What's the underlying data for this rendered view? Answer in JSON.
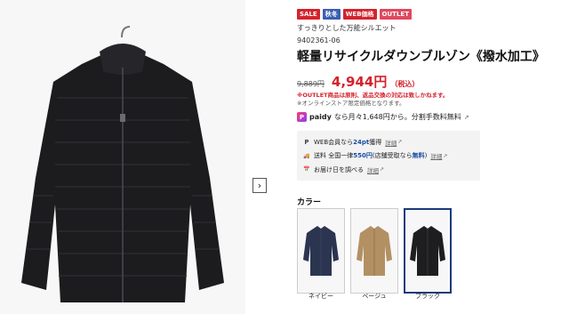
{
  "product": {
    "badges": [
      {
        "label": "SALE",
        "color": "#d4232c"
      },
      {
        "label": "秋冬",
        "color": "#3a5fb0"
      },
      {
        "label": "WEB価格",
        "color": "#d4232c"
      },
      {
        "label": "OUTLET",
        "color": "#e0485e"
      }
    ],
    "tagline": "すっきりとした万能シルエット",
    "code": "9402361-06",
    "title": "軽量リサイクルダウンブルゾン《撥水加工》",
    "old_price": "9,889円",
    "price": "4,944円",
    "tax_label": "（税込）",
    "note_outlet": "※OUTLET商品は原則、返品交換の対応は致しかねます。",
    "note_online": "※オンラインストア限定価格となります。",
    "paidy": {
      "logo_letter": "P",
      "brand": "paidy",
      "text": "なら月々1,648円から。分割手数料無料",
      "ext_icon": "↗"
    }
  },
  "services": {
    "points": {
      "icon": "P",
      "text_pre": "WEB会員なら",
      "highlight": "24pt",
      "text_post": "獲得",
      "link": "詳細"
    },
    "shipping": {
      "icon": "🚚",
      "text_pre": "送料 全国一律",
      "highlight": "550円",
      "text_mid": "(店舗受取なら",
      "highlight2": "無料",
      "text_post": ")",
      "link": "詳細"
    },
    "delivery": {
      "icon": "📅",
      "text": "お届け日を調べる",
      "link": "詳細"
    },
    "ext_icon": "↗"
  },
  "gallery": {
    "next_label": "›",
    "main_color": "#1c1c1f"
  },
  "colors": {
    "label": "カラー",
    "selected_index": 2,
    "options": [
      {
        "name": "ネイビー",
        "hex": "#2b3550"
      },
      {
        "name": "ベージュ",
        "hex": "#b39063"
      },
      {
        "name": "ブラック",
        "hex": "#1e1e21"
      }
    ]
  }
}
